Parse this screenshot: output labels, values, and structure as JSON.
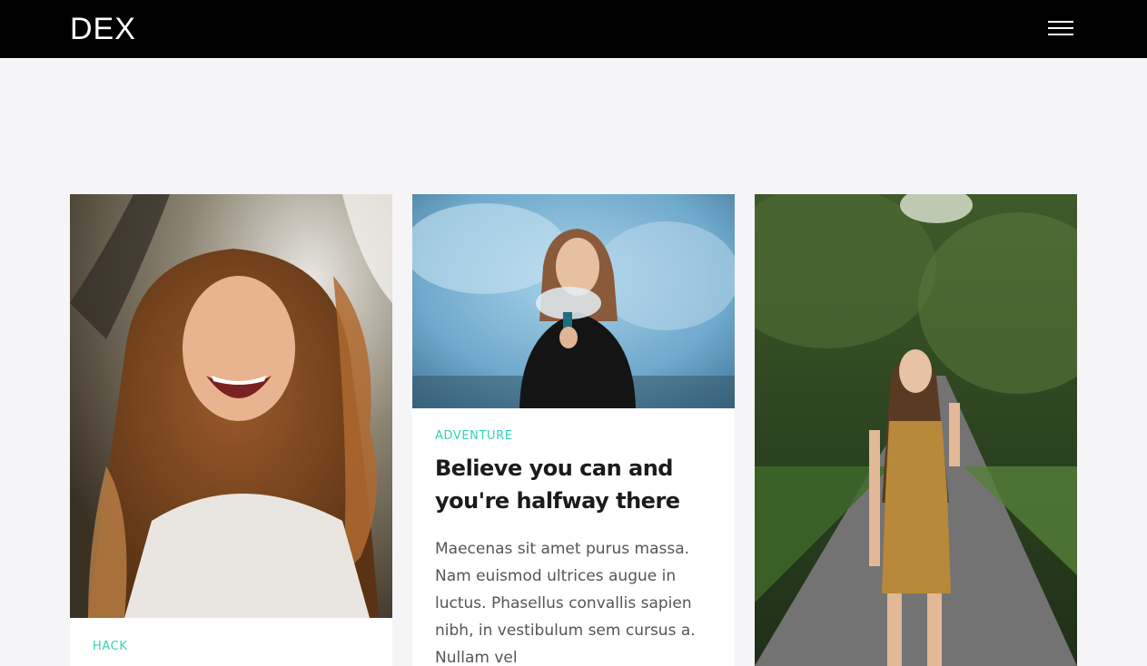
{
  "header": {
    "logo": "DEX",
    "menu_icon": "hamburger-menu-icon"
  },
  "colors": {
    "header_bg": "#000000",
    "page_bg": "#f5f5f7",
    "accent": "#2fd3b7",
    "title": "#1b1b1b",
    "body_text": "#555555"
  },
  "cards": [
    {
      "image": "photo-woman-curly-hair-laughing",
      "category": "HACK"
    },
    {
      "image": "photo-woman-blue-smoke",
      "category": "ADVENTURE",
      "title": "Believe you can and you're halfway there",
      "excerpt": "Maecenas sit amet purus massa. Nam euismod ultrices augue in luctus. Phasellus convallis sapien nibh, in vestibulum sem cursus a. Nullam vel"
    },
    {
      "image": "photo-woman-forest-road"
    }
  ]
}
